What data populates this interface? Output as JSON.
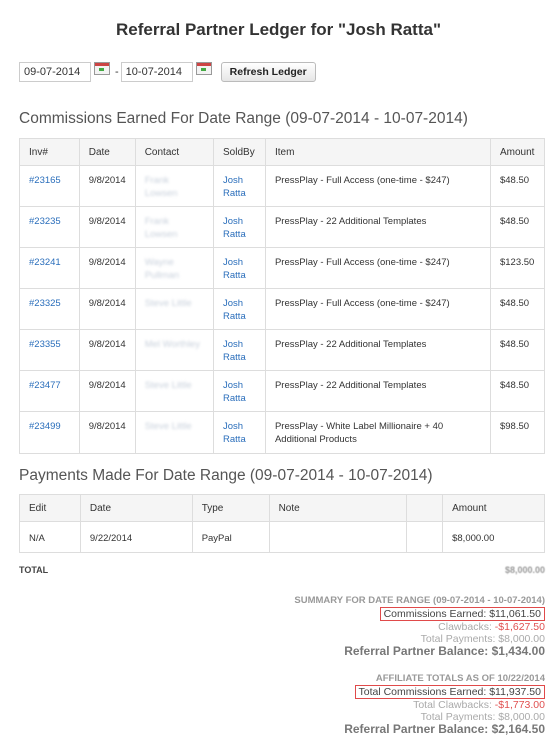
{
  "page": {
    "title": "Referral Partner Ledger for \"Josh Ratta\""
  },
  "filters": {
    "start_date": "09-07-2014",
    "end_date": "10-07-2014",
    "separator": "-",
    "refresh_label": "Refresh Ledger"
  },
  "commissions": {
    "heading": "Commissions Earned For Date Range (09-07-2014 - 10-07-2014)",
    "columns": [
      "Inv#",
      "Date",
      "Contact",
      "SoldBy",
      "Item",
      "Amount"
    ],
    "rows": [
      {
        "inv": "#23165",
        "date": "9/8/2014",
        "contact": "Frank Lowsen",
        "sold_by": [
          "Josh",
          "Ratta"
        ],
        "item": "PressPlay - Full Access (one-time - $247)",
        "amount": "$48.50"
      },
      {
        "inv": "#23235",
        "date": "9/8/2014",
        "contact": "Frank Lowsen",
        "sold_by": [
          "Josh",
          "Ratta"
        ],
        "item": "PressPlay - 22 Additional Templates",
        "amount": "$48.50"
      },
      {
        "inv": "#23241",
        "date": "9/8/2014",
        "contact": "Wayne Pullman",
        "sold_by": [
          "Josh",
          "Ratta"
        ],
        "item": "PressPlay - Full Access (one-time - $247)",
        "amount": "$123.50"
      },
      {
        "inv": "#23325",
        "date": "9/8/2014",
        "contact": "Steve Little",
        "sold_by": [
          "Josh",
          "Ratta"
        ],
        "item": "PressPlay - Full Access (one-time - $247)",
        "amount": "$48.50"
      },
      {
        "inv": "#23355",
        "date": "9/8/2014",
        "contact": "Mel Worthley",
        "sold_by": [
          "Josh",
          "Ratta"
        ],
        "item": "PressPlay - 22 Additional Templates",
        "amount": "$48.50"
      },
      {
        "inv": "#23477",
        "date": "9/8/2014",
        "contact": "Steve Little",
        "sold_by": [
          "Josh",
          "Ratta"
        ],
        "item": "PressPlay - 22 Additional Templates",
        "amount": "$48.50"
      },
      {
        "inv": "#23499",
        "date": "9/8/2014",
        "contact": "Steve Little",
        "sold_by": [
          "Josh",
          "Ratta"
        ],
        "item": "PressPlay - White Label Millionaire + 40 Additional Products",
        "amount": "$98.50"
      }
    ]
  },
  "payments": {
    "heading": "Payments Made For Date Range (09-07-2014 - 10-07-2014)",
    "columns": [
      "Edit",
      "Date",
      "Type",
      "Note",
      "",
      "Amount"
    ],
    "rows": [
      {
        "edit": "N/A",
        "date": "9/22/2014",
        "type": "PayPal",
        "note": "",
        "amount": "$8,000.00"
      }
    ]
  },
  "total": {
    "label": "TOTAL",
    "amount": "$8,000.00"
  },
  "summary": {
    "heading": "SUMMARY FOR DATE RANGE (09-07-2014 - 10-07-2014)",
    "commissions_earned": "Commissions Earned: $11,061.50",
    "clawbacks_label": "Clawbacks:",
    "clawbacks_value": "-$1,627.50",
    "total_payments": "Total Payments: $8,000.00",
    "balance": "Referral Partner Balance: $1,434.00"
  },
  "affiliate_totals": {
    "heading": "AFFILIATE TOTALS AS OF 10/22/2014",
    "total_commissions": "Total Commissions Earned: $11,937.50",
    "clawbacks_label": "Total Clawbacks:",
    "clawbacks_value": "-$1,773.00",
    "total_payments": "Total Payments: $8,000.00",
    "balance": "Referral Partner Balance: $2,164.50"
  },
  "colors": {
    "link": "#2a6ebb",
    "highlight_box": "#e04a4a",
    "negative": "#e05050"
  }
}
